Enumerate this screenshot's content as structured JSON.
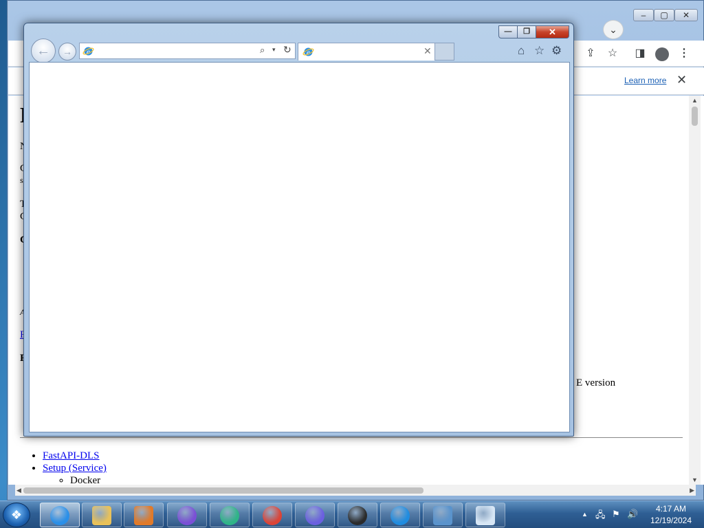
{
  "chrome": {
    "title": "",
    "infobar": {
      "learn_more": "Learn more",
      "close_glyph": "✕"
    },
    "toolbar": {
      "share": "⇪",
      "star": "☆",
      "side_panel": "◨",
      "menu": "⋮"
    },
    "tab_dropdown": "⌄",
    "caption": {
      "min": "–",
      "max": "▢",
      "close": "✕"
    },
    "page": {
      "heading": "F",
      "lines": [
        {
          "text": "N",
          "style": "normal"
        },
        {
          "text": "G",
          "style": "normal"
        },
        {
          "text": "s",
          "style": "normal"
        },
        {
          "text": "T",
          "style": "normal"
        },
        {
          "text": "C",
          "style": "normal"
        },
        {
          "text": "C",
          "style": "bold"
        },
        {
          "text": "A",
          "style": "italic"
        },
        {
          "text": "R",
          "style": "link"
        },
        {
          "text": "F",
          "style": "bold"
        }
      ],
      "right_text": "E version",
      "list": [
        {
          "label": "FastAPI-DLS",
          "link": true
        },
        {
          "label": "Setup (Service)",
          "link": true
        },
        {
          "label": "Docker",
          "link": false,
          "nested": true
        }
      ]
    }
  },
  "ie": {
    "caption": {
      "min": "—",
      "max": "❐",
      "close": "✕"
    },
    "back_glyph": "←",
    "forward_glyph": "→",
    "address": {
      "value": "",
      "placeholder": ""
    },
    "address_glyphs": {
      "search": "⌕",
      "dropdown": "▾",
      "refresh": "↻"
    },
    "tab": {
      "title": "",
      "close_glyph": "✕"
    },
    "tools": {
      "home": "⌂",
      "favorites": "☆",
      "settings": "⚙"
    }
  },
  "taskbar": {
    "start_glyph": "❖",
    "apps": [
      {
        "name": "internet-explorer",
        "color": "#2a8fe8",
        "active": true
      },
      {
        "name": "file-explorer",
        "color": "#e8c15a",
        "active": false
      },
      {
        "name": "media-player",
        "color": "#e07a2a",
        "active": false
      },
      {
        "name": "firefox",
        "color": "#7b4fd6",
        "active": false
      },
      {
        "name": "edge-dev",
        "color": "#2fb487",
        "active": false
      },
      {
        "name": "chrome",
        "color": "#db4437",
        "active": false
      },
      {
        "name": "firefox-nightly",
        "color": "#6b5fe0",
        "active": false
      },
      {
        "name": "obs-studio",
        "color": "#2b2b2b",
        "active": false
      },
      {
        "name": "edge",
        "color": "#1f8ce0",
        "active": false
      },
      {
        "name": "control-panel",
        "color": "#5a93cc",
        "active": false
      },
      {
        "name": "virtual-machine",
        "color": "#d7e6f5",
        "active": false
      }
    ],
    "tray": {
      "show_hidden": "▲",
      "network": "🖧",
      "flag": "⚑",
      "volume": "🔊"
    },
    "clock": {
      "time": "4:17 AM",
      "date": "12/19/2024"
    }
  }
}
